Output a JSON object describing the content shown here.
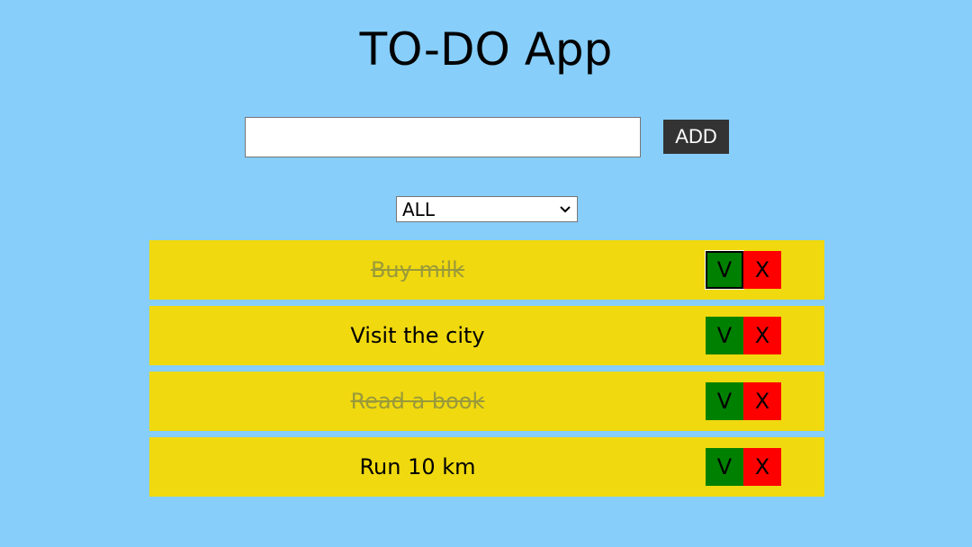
{
  "app": {
    "title": "TO-DO App"
  },
  "form": {
    "input_value": "",
    "input_placeholder": "",
    "add_label": "ADD"
  },
  "filter": {
    "selected": "ALL"
  },
  "todos": [
    {
      "text": "Buy milk",
      "completed": true,
      "check_label": "V",
      "delete_label": "X"
    },
    {
      "text": "Visit the city",
      "completed": false,
      "check_label": "V",
      "delete_label": "X"
    },
    {
      "text": "Read a book",
      "completed": true,
      "check_label": "V",
      "delete_label": "X"
    },
    {
      "text": "Run 10 km",
      "completed": false,
      "check_label": "V",
      "delete_label": "X"
    }
  ],
  "colors": {
    "background": "#87cefa",
    "item_background": "#f0d90f",
    "check_button": "#008000",
    "delete_button": "#ff0000",
    "add_button": "#333333",
    "completed_text": "#9a9a3a"
  },
  "icons": {
    "filter_dropdown": "chevron-down-icon"
  }
}
